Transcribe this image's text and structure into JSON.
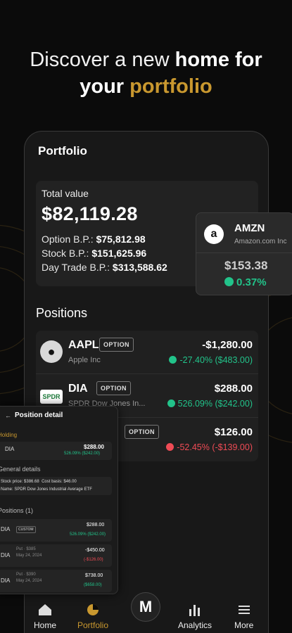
{
  "headline": {
    "part1": "Discover a new ",
    "bold1": "home for",
    "bold2": "your ",
    "accent": "portfolio"
  },
  "portfolio": {
    "title": "Portfolio",
    "total_label": "Total value",
    "total_value": "$82,119.28",
    "option_bp_label": "Option B.P.: ",
    "option_bp": "$75,812.98",
    "stock_bp_label": "Stock B.P.: ",
    "stock_bp": "$151,625.96",
    "daytrade_bp_label": "Day Trade B.P.: ",
    "daytrade_bp": "$313,588.62"
  },
  "positions": {
    "title": "Positions",
    "rows": [
      {
        "ticker": "AAPL",
        "tag": "OPTION",
        "name": "Apple Inc",
        "price": "-$1,280.00",
        "change": "-27.40% ($483.00)",
        "direction": "up"
      },
      {
        "ticker": "DIA",
        "tag": "OPTION",
        "name": "SPDR Dow Jones In...",
        "price": "$288.00",
        "change": "526.09% ($242.00)",
        "direction": "up",
        "logo_text": "SPDR"
      },
      {
        "ticker": "",
        "tag": "OPTION",
        "name": "",
        "price": "$126.00",
        "change": "-52.45% (-$139.00)",
        "direction": "down"
      }
    ]
  },
  "amzn": {
    "ticker": "AMZN",
    "name": "Amazon.com Inc",
    "price": "$153.38",
    "change": "0.37%",
    "logo": "a"
  },
  "detail": {
    "title": "Position detail",
    "holding_label": "Holding",
    "holding_ticker": "DIA",
    "holding_price": "$288.00",
    "holding_change": "526.09% ($242.00)",
    "general_label": "General details",
    "stock_price_label": "Stock price: ",
    "stock_price": "$386.68",
    "cost_basis_label": "Cost basis: ",
    "cost_basis": "$46.00",
    "name_label": "Name: ",
    "name": "SPDR Dow Jones Industrial Average ETF",
    "positions_label": "Positions (1)",
    "rows": [
      {
        "ticker": "DIA",
        "tag": "CUSTOM",
        "price": "$288.00",
        "change": "526.09% ($242.00)",
        "dir": "up"
      },
      {
        "ticker": "DIA",
        "sub": "Put · $385",
        "date": "May 24, 2024",
        "price": "-$450.00",
        "change": "(-$126.00)",
        "dir": "down"
      },
      {
        "ticker": "DIA",
        "sub": "Put · $390",
        "date": "May 24, 2024",
        "price": "$738.00",
        "change": "($658.00)",
        "dir": "up"
      }
    ]
  },
  "tabs": {
    "home": "Home",
    "portfolio": "Portfolio",
    "analytics": "Analytics",
    "more": "More",
    "center_logo": "M"
  },
  "colors": {
    "accent": "#c9982f",
    "positive": "#22c38a",
    "negative": "#ef4b55",
    "background": "#0b0b0b"
  }
}
